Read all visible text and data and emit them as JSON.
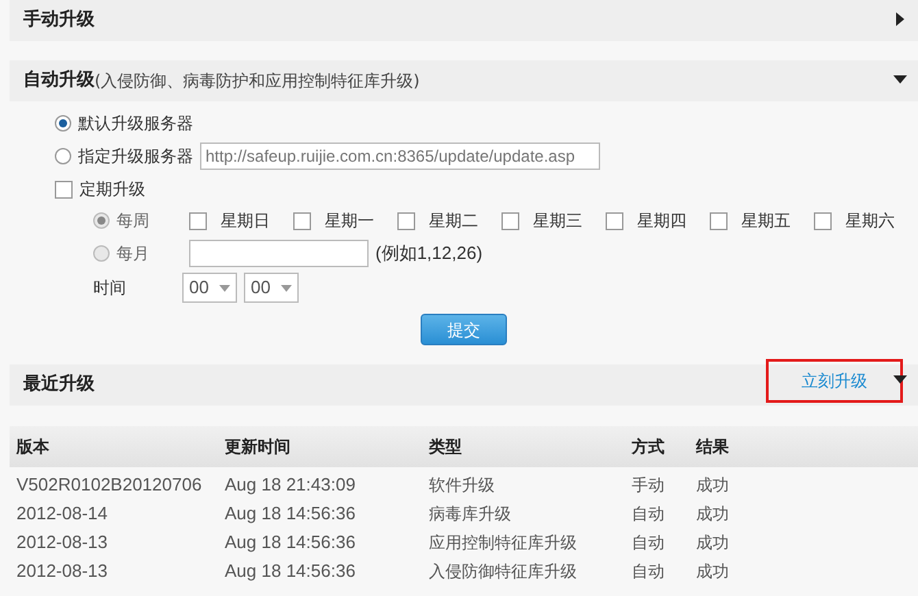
{
  "manual_upgrade": {
    "title": "手动升级",
    "expanded": false
  },
  "auto_upgrade": {
    "title": "自动升级",
    "subtitle": "(入侵防御、病毒防护和应用控制特征库升级)",
    "expanded": true,
    "server_options": [
      {
        "label": "默认升级服务器",
        "selected": true
      },
      {
        "label": "指定升级服务器",
        "selected": false,
        "placeholder": "http://safeup.ruijie.com.cn:8365/update/update.asp"
      }
    ],
    "scheduled": {
      "label": "定期升级",
      "checked": false
    },
    "weekly": {
      "label": "每周",
      "selected": true,
      "disabled": true,
      "days": [
        {
          "label": "星期日",
          "checked": false
        },
        {
          "label": "星期一",
          "checked": false
        },
        {
          "label": "星期二",
          "checked": false
        },
        {
          "label": "星期三",
          "checked": false
        },
        {
          "label": "星期四",
          "checked": false
        },
        {
          "label": "星期五",
          "checked": false
        },
        {
          "label": "星期六",
          "checked": false
        }
      ]
    },
    "monthly": {
      "label": "每月",
      "selected": false,
      "disabled": true,
      "hint": "(例如1,12,26)"
    },
    "time": {
      "label": "时间",
      "hour": "00",
      "minute": "00"
    },
    "submit": "提交"
  },
  "recent_upgrades": {
    "title": "最近升级",
    "upgrade_now": "立刻升级",
    "expanded": true,
    "columns": [
      "版本",
      "更新时间",
      "类型",
      "方式",
      "结果"
    ],
    "rows": [
      [
        "V502R0102B20120706",
        "Aug 18 21:43:09",
        "软件升级",
        "手动",
        "成功"
      ],
      [
        "2012-08-14",
        "Aug 18 14:56:36",
        "病毒库升级",
        "自动",
        "成功"
      ],
      [
        "2012-08-13",
        "Aug 18 14:56:36",
        "应用控制特征库升级",
        "自动",
        "成功"
      ],
      [
        "2012-08-13",
        "Aug 18 14:56:36",
        "入侵防御特征库升级",
        "自动",
        "成功"
      ]
    ]
  }
}
